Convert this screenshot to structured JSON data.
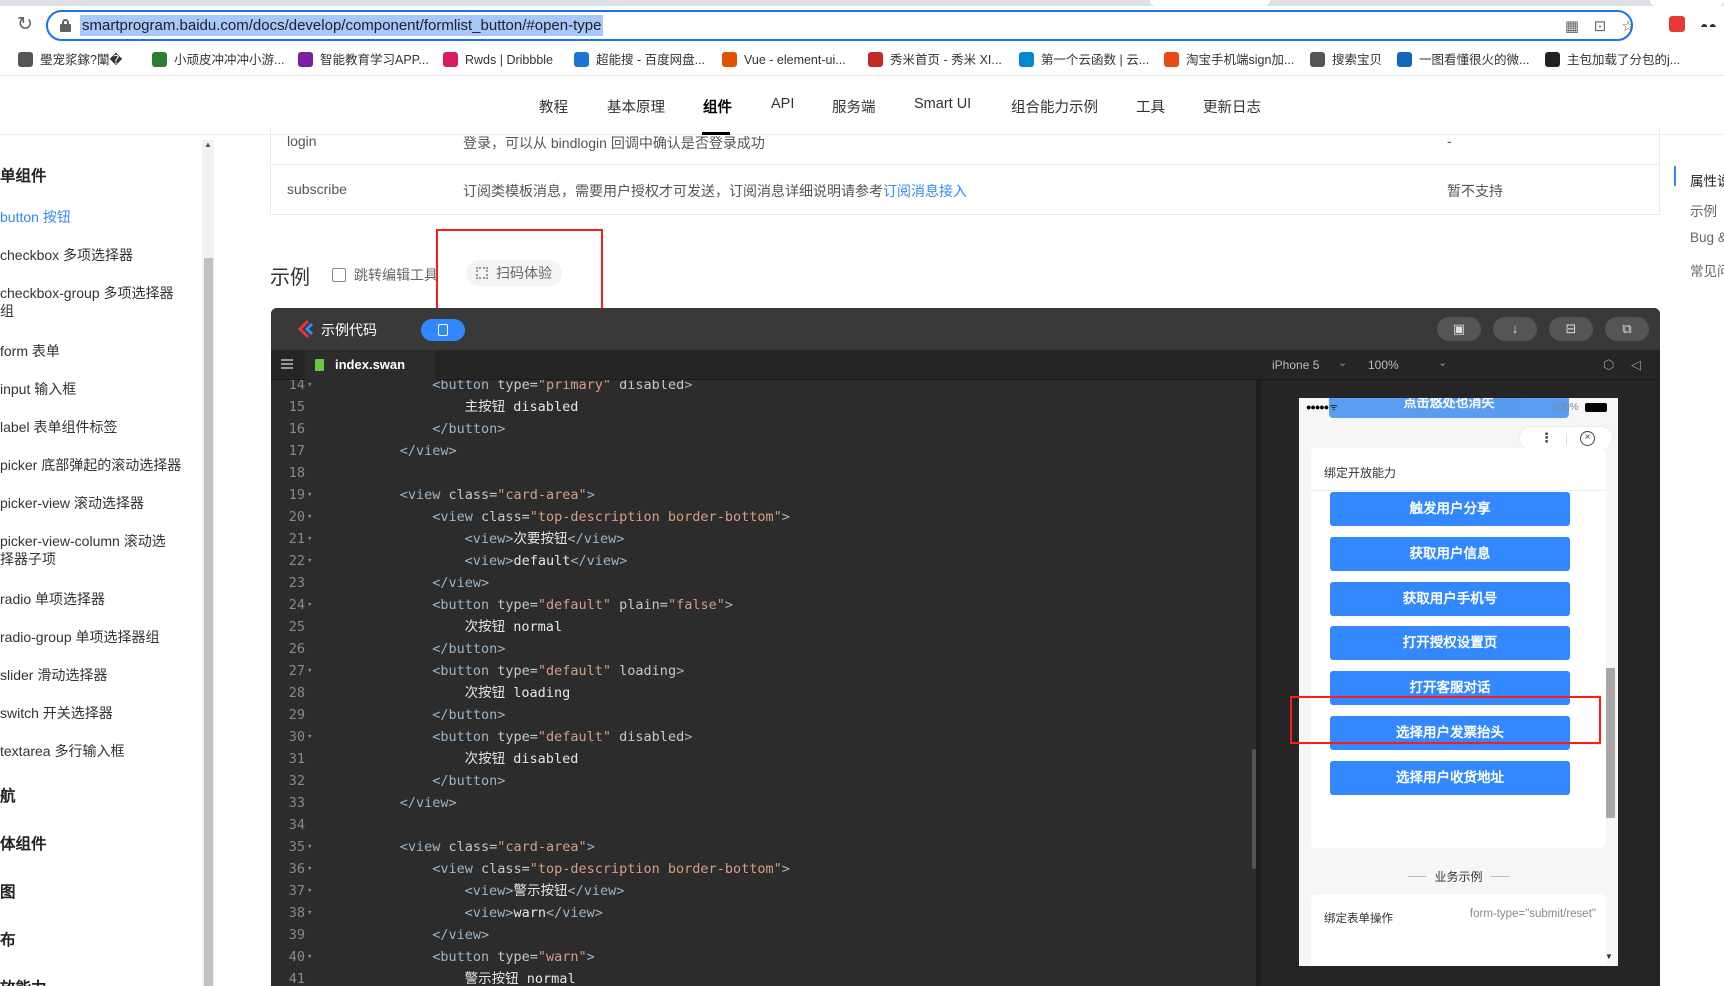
{
  "browser": {
    "url": "smartprogram.baidu.com/docs/develop/component/formlist_button/#open-type",
    "bookmarks": [
      {
        "label": "璺宠浆鎵?闈�",
        "color": "#555"
      },
      {
        "label": "小顽皮冲冲冲小游...",
        "color": "#2e7d32"
      },
      {
        "label": "智能教育学习APP...",
        "color": "#7b1fa2"
      },
      {
        "label": "Rwds | Dribbble",
        "color": "#d81b60"
      },
      {
        "label": "超能搜 - 百度网盘...",
        "color": "#1976d2"
      },
      {
        "label": "Vue - element-ui...",
        "color": "#e65100"
      },
      {
        "label": "秀米首页 - 秀米 XI...",
        "color": "#c62828"
      },
      {
        "label": "第一个云函数 | 云...",
        "color": "#0288d1"
      },
      {
        "label": "淘宝手机端sign加...",
        "color": "#e64a19"
      },
      {
        "label": "搜索宝贝",
        "color": "#555"
      },
      {
        "label": "一图看懂很火的微...",
        "color": "#1565c0"
      },
      {
        "label": "主包加载了分包的j...",
        "color": "#222"
      }
    ]
  },
  "topnav": {
    "items": [
      "教程",
      "基本原理",
      "组件",
      "API",
      "服务端",
      "Smart UI",
      "组合能力示例",
      "工具",
      "更新日志"
    ],
    "active": "组件"
  },
  "sidebar": {
    "group1": "单组件",
    "items": [
      "button 按钮",
      "checkbox 多项选择器",
      "checkbox-group 多项选择器",
      "组",
      "form 表单",
      "input 输入框",
      "label 表单组件标签",
      "picker 底部弹起的滚动选择器",
      "picker-view 滚动选择器",
      "picker-view-column 滚动选",
      "择器子项",
      "radio 单项选择器",
      "radio-group 单项选择器组",
      "slider 滑动选择器",
      "switch 开关选择器",
      "textarea 多行输入框"
    ],
    "groups": [
      "航",
      "体组件",
      "图",
      "布",
      "放能力"
    ]
  },
  "toc": {
    "items": [
      "属性说",
      "示例",
      "Bug &",
      "常见问"
    ]
  },
  "attr_table": {
    "row1": {
      "name": "login",
      "desc": "登录，可以从 bindlogin 回调中确认是否登录成功",
      "support": "-"
    },
    "row2": {
      "name": "subscribe",
      "desc": "订阅类模板消息，需要用户授权才可发送，订阅消息详细说明请参考",
      "link": "订阅消息接入",
      "support": "暂不支持"
    }
  },
  "example": {
    "heading": "示例",
    "jump_label": "跳转编辑工具",
    "scan_label": "扫码体验"
  },
  "editor": {
    "title": "示例代码",
    "file": "index.swan",
    "device": "iPhone 5",
    "zoom": "100%",
    "lines": [
      {
        "n": "14",
        "fold": true,
        "indent": 10,
        "html": "<span class='tag'>&lt;button</span> <span class='attr'>type=</span><span class='str'>\"primary\"</span> <span class='attr'>disabled</span><span class='tag'>&gt;</span>"
      },
      {
        "n": "15",
        "fold": false,
        "indent": 14,
        "html": "<span class='txt'>主按钮 disabled</span>"
      },
      {
        "n": "16",
        "fold": false,
        "indent": 10,
        "html": "<span class='tag'>&lt;/button&gt;</span>"
      },
      {
        "n": "17",
        "fold": false,
        "indent": 6,
        "html": "<span class='tag'>&lt;/view&gt;</span>"
      },
      {
        "n": "18",
        "fold": false,
        "indent": 0,
        "html": ""
      },
      {
        "n": "19",
        "fold": true,
        "indent": 6,
        "html": "<span class='tag'>&lt;view</span> <span class='attr'>class=</span><span class='str'>\"card-area\"</span><span class='tag'>&gt;</span>"
      },
      {
        "n": "20",
        "fold": true,
        "indent": 10,
        "html": "<span class='tag'>&lt;view</span> <span class='attr'>class=</span><span class='str'>\"top-description border-bottom\"</span><span class='tag'>&gt;</span>"
      },
      {
        "n": "21",
        "fold": true,
        "indent": 14,
        "html": "<span class='tag'>&lt;view&gt;</span><span class='txt'>次要按钮</span><span class='tag'>&lt;/view&gt;</span>"
      },
      {
        "n": "22",
        "fold": true,
        "indent": 14,
        "html": "<span class='tag'>&lt;view&gt;</span><span class='txt'>default</span><span class='tag'>&lt;/view&gt;</span>"
      },
      {
        "n": "23",
        "fold": false,
        "indent": 10,
        "html": "<span class='tag'>&lt;/view&gt;</span>"
      },
      {
        "n": "24",
        "fold": true,
        "indent": 10,
        "html": "<span class='tag'>&lt;button</span> <span class='attr'>type=</span><span class='str'>\"default\"</span> <span class='attr'>plain=</span><span class='str'>\"false\"</span><span class='tag'>&gt;</span>"
      },
      {
        "n": "25",
        "fold": false,
        "indent": 14,
        "html": "<span class='txt'>次按钮 normal</span>"
      },
      {
        "n": "26",
        "fold": false,
        "indent": 10,
        "html": "<span class='tag'>&lt;/button&gt;</span>"
      },
      {
        "n": "27",
        "fold": true,
        "indent": 10,
        "html": "<span class='tag'>&lt;button</span> <span class='attr'>type=</span><span class='str'>\"default\"</span> <span class='attr'>loading</span><span class='tag'>&gt;</span>"
      },
      {
        "n": "28",
        "fold": false,
        "indent": 14,
        "html": "<span class='txt'>次按钮 loading</span>"
      },
      {
        "n": "29",
        "fold": false,
        "indent": 10,
        "html": "<span class='tag'>&lt;/button&gt;</span>"
      },
      {
        "n": "30",
        "fold": true,
        "indent": 10,
        "html": "<span class='tag'>&lt;button</span> <span class='attr'>type=</span><span class='str'>\"default\"</span> <span class='attr'>disabled</span><span class='tag'>&gt;</span>"
      },
      {
        "n": "31",
        "fold": false,
        "indent": 14,
        "html": "<span class='txt'>次按钮 disabled</span>"
      },
      {
        "n": "32",
        "fold": false,
        "indent": 10,
        "html": "<span class='tag'>&lt;/button&gt;</span>"
      },
      {
        "n": "33",
        "fold": false,
        "indent": 6,
        "html": "<span class='tag'>&lt;/view&gt;</span>"
      },
      {
        "n": "34",
        "fold": false,
        "indent": 0,
        "html": ""
      },
      {
        "n": "35",
        "fold": true,
        "indent": 6,
        "html": "<span class='tag'>&lt;view</span> <span class='attr'>class=</span><span class='str'>\"card-area\"</span><span class='tag'>&gt;</span>"
      },
      {
        "n": "36",
        "fold": true,
        "indent": 10,
        "html": "<span class='tag'>&lt;view</span> <span class='attr'>class=</span><span class='str'>\"top-description border-bottom\"</span><span class='tag'>&gt;</span>"
      },
      {
        "n": "37",
        "fold": true,
        "indent": 14,
        "html": "<span class='tag'>&lt;view&gt;</span><span class='txt'>警示按钮</span><span class='tag'>&lt;/view&gt;</span>"
      },
      {
        "n": "38",
        "fold": true,
        "indent": 14,
        "html": "<span class='tag'>&lt;view&gt;</span><span class='txt'>warn</span><span class='tag'>&lt;/view&gt;</span>"
      },
      {
        "n": "39",
        "fold": false,
        "indent": 10,
        "html": "<span class='tag'>&lt;/view&gt;</span>"
      },
      {
        "n": "40",
        "fold": true,
        "indent": 10,
        "html": "<span class='tag'>&lt;button</span> <span class='attr'>type=</span><span class='str'>\"warn\"</span><span class='tag'>&gt;</span>"
      },
      {
        "n": "41",
        "fold": false,
        "indent": 14,
        "html": "<span class='txt'>警示按钮 normal</span>"
      }
    ]
  },
  "phone": {
    "status_pct": "100%",
    "ghost_btn": "点击悠处也消失",
    "card_title": "绑定开放能力",
    "buttons": [
      "触发用户分享",
      "获取用户信息",
      "获取用户手机号",
      "打开授权设置页",
      "打开客服对话",
      "选择用户发票抬头",
      "选择用户收货地址"
    ],
    "biz_label": "业务示例",
    "form_label": "绑定表单操作",
    "form_value": "form-type=\"submit/reset\""
  }
}
